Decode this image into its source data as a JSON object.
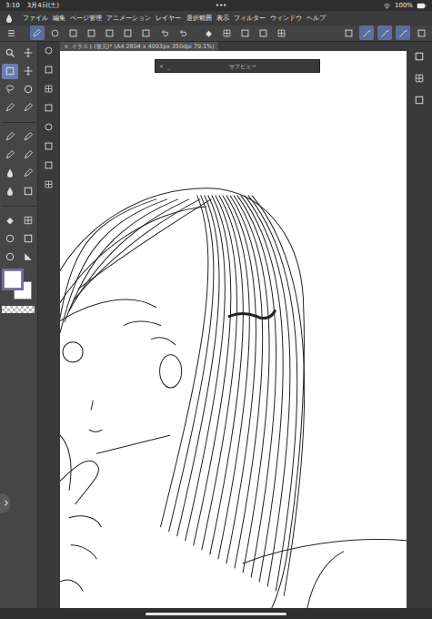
{
  "status_bar": {
    "time": "3:10",
    "date": "3月4日(土)",
    "dots": "•••",
    "battery": "100%"
  },
  "menu": {
    "items": [
      "ファイル",
      "編集",
      "ページ管理",
      "アニメーション",
      "レイヤー",
      "選択範囲",
      "表示",
      "フィルター",
      "ウィンドウ",
      "ヘルプ"
    ]
  },
  "toolbar": {
    "buttons": [
      {
        "selected": false
      },
      {
        "selected": true
      },
      {
        "selected": false
      },
      {
        "selected": false
      },
      {
        "selected": false
      },
      {
        "selected": false
      },
      {
        "selected": false
      },
      {
        "selected": false
      },
      {
        "selected": false
      },
      {
        "selected": false
      },
      {
        "selected": false
      },
      {
        "selected": false
      },
      {
        "selected": false
      },
      {
        "selected": false
      },
      {
        "selected": false
      },
      {
        "selected": false
      },
      {
        "selected": true
      },
      {
        "selected": true
      },
      {
        "selected": true
      },
      {
        "selected": false
      }
    ]
  },
  "tools": [
    {
      "selected": false
    },
    {
      "selected": false
    },
    {
      "selected": true
    },
    {
      "selected": false
    },
    {
      "selected": false
    },
    {
      "selected": false
    },
    {
      "selected": false
    },
    {
      "selected": false
    },
    {
      "selected": false
    },
    {
      "selected": false
    },
    {
      "selected": false
    },
    {
      "selected": false
    },
    {
      "selected": false
    },
    {
      "selected": false
    },
    {
      "selected": false
    },
    {
      "selected": false
    },
    {
      "selected": false
    },
    {
      "selected": false
    },
    {
      "selected": false
    },
    {
      "selected": false
    },
    {
      "selected": false
    },
    {
      "selected": false
    }
  ],
  "colors": {
    "main": "#ffffff",
    "sub": "#ffffff",
    "main_selected": true
  },
  "canvas_tab": {
    "close": "×",
    "title": "イラスト(復元)* (A4 2894 x 4093px 350dpi 79.1%)"
  },
  "subview": {
    "close": "×",
    "minimize": "_",
    "title": "サブビュー"
  }
}
